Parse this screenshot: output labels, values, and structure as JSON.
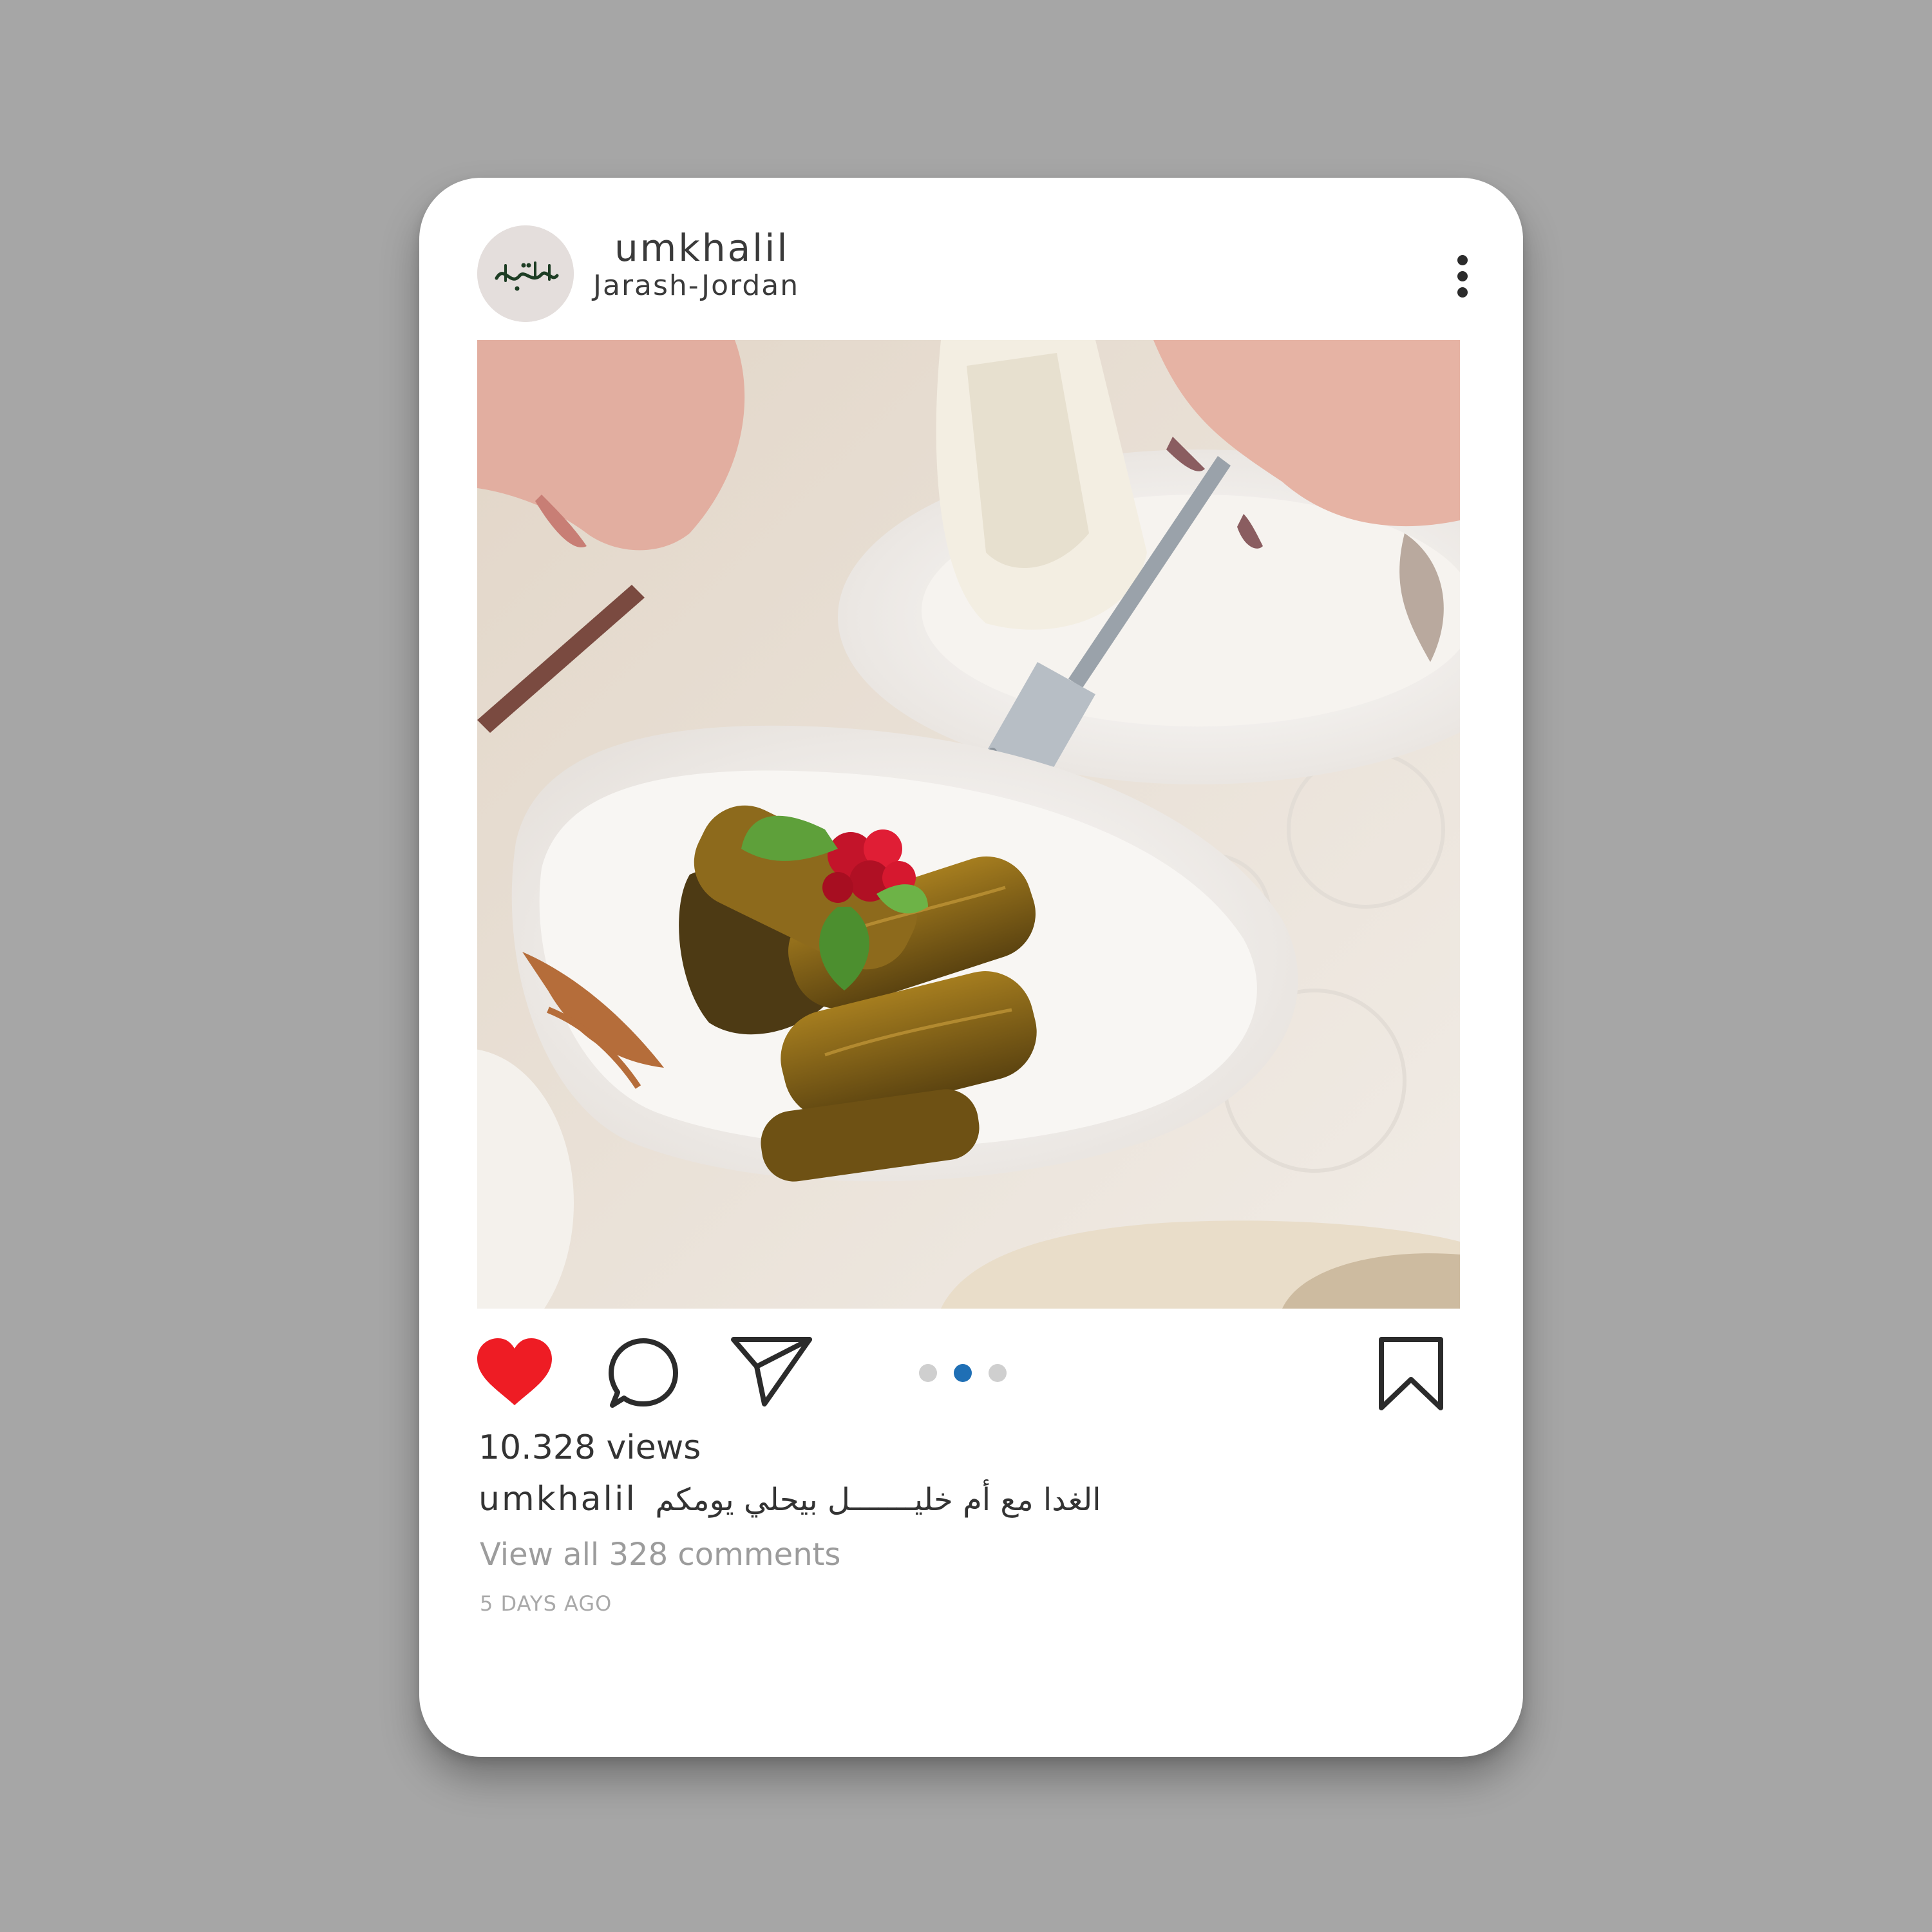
{
  "post": {
    "username": "umkhalil",
    "location": "Jarash-Jordan",
    "logo_text": "أم خليل",
    "views": "10.328 views",
    "caption_user": "umkhalil",
    "caption_text": "الغدا مع أم خليـــــــل بيحلي يومكم",
    "view_comments": "View all 328 comments",
    "time_ago": "5 DAYS AGO"
  },
  "actions": {
    "like_icon": "heart-icon",
    "like_state": "liked",
    "comment_icon": "comment-icon",
    "share_icon": "send-icon",
    "save_icon": "bookmark-icon",
    "more_icon": "more-vertical-icon"
  },
  "carousel": {
    "total": 3,
    "active_index": 2
  },
  "colors": {
    "background": "#a6a6a6",
    "card": "#ffffff",
    "like": "#ee1c24",
    "active_dot": "#1f6fb5",
    "inactive_dot": "#cfcfcf",
    "text": "#333333",
    "muted_text": "#9c9c9c"
  }
}
